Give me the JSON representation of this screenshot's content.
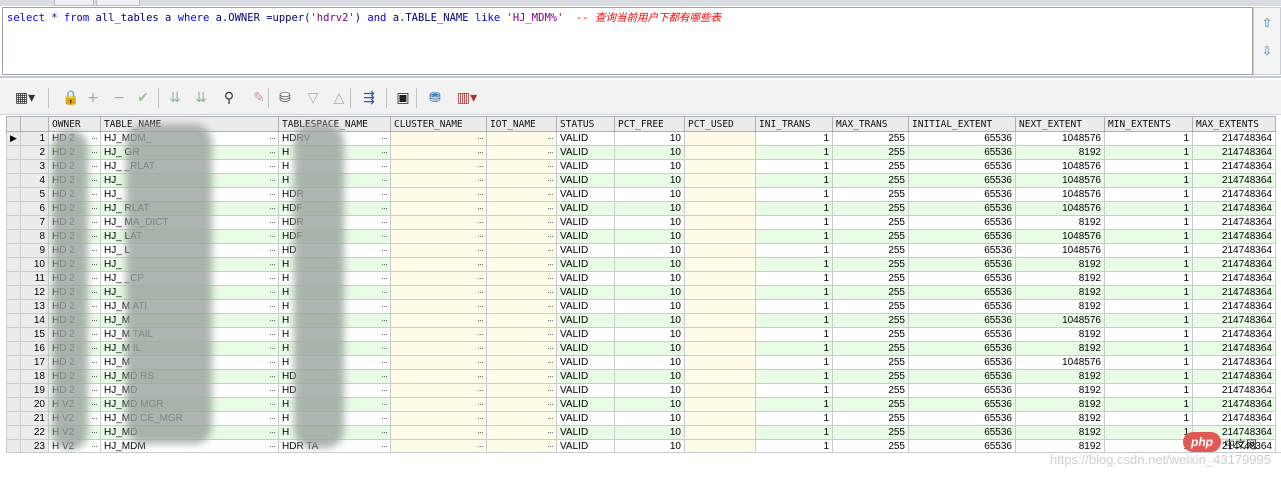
{
  "query": {
    "sql_parts": [
      {
        "t": "select",
        "c": "kw"
      },
      {
        "t": " * ",
        "c": ""
      },
      {
        "t": "from",
        "c": "kw"
      },
      {
        "t": " all_tables a ",
        "c": ""
      },
      {
        "t": "where",
        "c": "kw"
      },
      {
        "t": " a.OWNER =upper(",
        "c": ""
      },
      {
        "t": "'hdrv2'",
        "c": "str"
      },
      {
        "t": ") ",
        "c": ""
      },
      {
        "t": "and",
        "c": "kw"
      },
      {
        "t": " a.TABLE_NAME ",
        "c": ""
      },
      {
        "t": "like",
        "c": "kw"
      },
      {
        "t": " ",
        "c": ""
      },
      {
        "t": "'HJ_MDM%'",
        "c": "str"
      },
      {
        "t": "  -- 查询当前用户下都有哪些表",
        "c": "cmt"
      }
    ]
  },
  "editor_buttons": {
    "up": "⇧",
    "down": "⇩"
  },
  "toolbar": [
    {
      "name": "grid-menu-icon",
      "glyph": "▦▾",
      "color": "#333"
    },
    {
      "name": "lock-icon",
      "glyph": "🔒",
      "color": "#444"
    },
    {
      "name": "add-record-icon",
      "glyph": "+",
      "color": "#9aa"
    },
    {
      "name": "delete-record-icon",
      "glyph": "−",
      "color": "#9aa"
    },
    {
      "name": "post-changes-icon",
      "glyph": "✔",
      "color": "#9bc09b"
    },
    {
      "name": "fetch-next-icon",
      "glyph": "⇊",
      "color": "#8fb88f"
    },
    {
      "name": "fetch-last-icon",
      "glyph": "⇊",
      "color": "#8fb88f"
    },
    {
      "name": "find-icon",
      "glyph": "⚲",
      "color": "#333"
    },
    {
      "name": "clear-icon",
      "glyph": "✎",
      "color": "#c99"
    },
    {
      "name": "query-by-example-icon",
      "glyph": "⛁",
      "color": "#555"
    },
    {
      "name": "filter-down-icon",
      "glyph": "▽",
      "color": "#aaa"
    },
    {
      "name": "filter-up-icon",
      "glyph": "△",
      "color": "#aaa"
    },
    {
      "name": "link-icon",
      "glyph": "⇶",
      "color": "#2d5fa8"
    },
    {
      "name": "save-icon",
      "glyph": "▣",
      "color": "#222"
    },
    {
      "name": "export-icon",
      "glyph": "⛃",
      "color": "#2a6fb0"
    },
    {
      "name": "chart-menu-icon",
      "glyph": "▥▾",
      "color": "#b03030"
    }
  ],
  "columns": [
    "",
    "",
    "OWNER",
    "TABLE_NAME",
    "TABLESPACE_NAME",
    "CLUSTER_NAME",
    "IOT_NAME",
    "STATUS",
    "PCT_FREE",
    "PCT_USED",
    "INI_TRANS",
    "MAX_TRANS",
    "INITIAL_EXTENT",
    "NEXT_EXTENT",
    "MIN_EXTENTS",
    "MAX_EXTENTS"
  ],
  "rows": [
    {
      "n": "1",
      "owner": "HD 2",
      "table": "HJ_MDM_",
      "ts": "HDRV",
      "status": "VALID",
      "pct_free": "10",
      "ini": "1",
      "max": "255",
      "initial": "65536",
      "next": "1048576",
      "min": "1",
      "maxe": "214748364"
    },
    {
      "n": "2",
      "owner": "HD 2",
      "table": "HJ_          GR",
      "ts": "H",
      "status": "VALID",
      "pct_free": "10",
      "ini": "1",
      "max": "255",
      "initial": "65536",
      "next": "8192",
      "min": "1",
      "maxe": "214748364"
    },
    {
      "n": "3",
      "owner": "HD 2",
      "table": "HJ_          _RLAT",
      "ts": "H",
      "status": "VALID",
      "pct_free": "10",
      "ini": "1",
      "max": "255",
      "initial": "65536",
      "next": "1048576",
      "min": "1",
      "maxe": "214748364"
    },
    {
      "n": "4",
      "owner": "HD 2",
      "table": "HJ_",
      "ts": "H",
      "status": "VALID",
      "pct_free": "10",
      "ini": "1",
      "max": "255",
      "initial": "65536",
      "next": "1048576",
      "min": "1",
      "maxe": "214748364"
    },
    {
      "n": "5",
      "owner": "HD 2",
      "table": "HJ_",
      "ts": "HDR",
      "status": "VALID",
      "pct_free": "10",
      "ini": "1",
      "max": "255",
      "initial": "65536",
      "next": "1048576",
      "min": "1",
      "maxe": "214748364"
    },
    {
      "n": "6",
      "owner": "HD 2",
      "table": "HJ_         RLAT",
      "ts": "HDF",
      "status": "VALID",
      "pct_free": "10",
      "ini": "1",
      "max": "255",
      "initial": "65536",
      "next": "1048576",
      "min": "1",
      "maxe": "214748364"
    },
    {
      "n": "7",
      "owner": "HD 2",
      "table": "HJ_         MA_DICT",
      "ts": "HDR",
      "status": "VALID",
      "pct_free": "10",
      "ini": "1",
      "max": "255",
      "initial": "65536",
      "next": "8192",
      "min": "1",
      "maxe": "214748364"
    },
    {
      "n": "8",
      "owner": "HD 2",
      "table": "HJ_         LAT",
      "ts": "HDF",
      "status": "VALID",
      "pct_free": "10",
      "ini": "1",
      "max": "255",
      "initial": "65536",
      "next": "1048576",
      "min": "1",
      "maxe": "214748364"
    },
    {
      "n": "9",
      "owner": "HD 2",
      "table": "HJ_         L",
      "ts": "HD",
      "status": "VALID",
      "pct_free": "10",
      "ini": "1",
      "max": "255",
      "initial": "65536",
      "next": "1048576",
      "min": "1",
      "maxe": "214748364"
    },
    {
      "n": "10",
      "owner": "HD 2",
      "table": "HJ_",
      "ts": "H",
      "status": "VALID",
      "pct_free": "10",
      "ini": "1",
      "max": "255",
      "initial": "65536",
      "next": "8192",
      "min": "1",
      "maxe": "214748364"
    },
    {
      "n": "11",
      "owner": "HD 2",
      "table": "HJ_          _CP",
      "ts": "H",
      "status": "VALID",
      "pct_free": "10",
      "ini": "1",
      "max": "255",
      "initial": "65536",
      "next": "8192",
      "min": "1",
      "maxe": "214748364"
    },
    {
      "n": "12",
      "owner": "HD 2",
      "table": "HJ_",
      "ts": "H",
      "status": "VALID",
      "pct_free": "10",
      "ini": "1",
      "max": "255",
      "initial": "65536",
      "next": "8192",
      "min": "1",
      "maxe": "214748364"
    },
    {
      "n": "13",
      "owner": "HD 2",
      "table": "HJ_M         ATI",
      "ts": "H",
      "status": "VALID",
      "pct_free": "10",
      "ini": "1",
      "max": "255",
      "initial": "65536",
      "next": "8192",
      "min": "1",
      "maxe": "214748364"
    },
    {
      "n": "14",
      "owner": "HD 2",
      "table": "HJ_M",
      "ts": "H",
      "status": "VALID",
      "pct_free": "10",
      "ini": "1",
      "max": "255",
      "initial": "65536",
      "next": "1048576",
      "min": "1",
      "maxe": "214748364"
    },
    {
      "n": "15",
      "owner": "HD 2",
      "table": "HJ_M         TAIL",
      "ts": "H",
      "status": "VALID",
      "pct_free": "10",
      "ini": "1",
      "max": "255",
      "initial": "65536",
      "next": "8192",
      "min": "1",
      "maxe": "214748364"
    },
    {
      "n": "16",
      "owner": "HD 2",
      "table": "HJ_M         IL",
      "ts": "H",
      "status": "VALID",
      "pct_free": "10",
      "ini": "1",
      "max": "255",
      "initial": "65536",
      "next": "8192",
      "min": "1",
      "maxe": "214748364"
    },
    {
      "n": "17",
      "owner": "HD 2",
      "table": "HJ_M",
      "ts": "H",
      "status": "VALID",
      "pct_free": "10",
      "ini": "1",
      "max": "255",
      "initial": "65536",
      "next": "1048576",
      "min": "1",
      "maxe": "214748364"
    },
    {
      "n": "18",
      "owner": "HD 2",
      "table": "HJ_MD        RS",
      "ts": "HD",
      "status": "VALID",
      "pct_free": "10",
      "ini": "1",
      "max": "255",
      "initial": "65536",
      "next": "8192",
      "min": "1",
      "maxe": "214748364"
    },
    {
      "n": "19",
      "owner": "HD 2",
      "table": "HJ_MD",
      "ts": "HD",
      "status": "VALID",
      "pct_free": "10",
      "ini": "1",
      "max": "255",
      "initial": "65536",
      "next": "8192",
      "min": "1",
      "maxe": "214748364"
    },
    {
      "n": "20",
      "owner": "H V2",
      "table": "HJ_MD        MGR",
      "ts": "H",
      "status": "VALID",
      "pct_free": "10",
      "ini": "1",
      "max": "255",
      "initial": "65536",
      "next": "8192",
      "min": "1",
      "maxe": "214748364"
    },
    {
      "n": "21",
      "owner": "H V2",
      "table": "HJ_MD        CE_MGR",
      "ts": "H",
      "status": "VALID",
      "pct_free": "10",
      "ini": "1",
      "max": "255",
      "initial": "65536",
      "next": "8192",
      "min": "1",
      "maxe": "214748364"
    },
    {
      "n": "22",
      "owner": "H V2",
      "table": "HJ_MD",
      "ts": "H",
      "status": "VALID",
      "pct_free": "10",
      "ini": "1",
      "max": "255",
      "initial": "65536",
      "next": "8192",
      "min": "1",
      "maxe": "214748364"
    },
    {
      "n": "23",
      "owner": "H V2",
      "table": "HJ_MDM",
      "ts": "HDR      TA",
      "status": "VALID",
      "pct_free": "10",
      "ini": "1",
      "max": "255",
      "initial": "65536",
      "next": "8192",
      "min": "1",
      "maxe": "214748364"
    }
  ],
  "overlay": {
    "php_badge": "php",
    "cn_label": "中文网",
    "watermark": "https://blog.csdn.net/weixin_43179995"
  },
  "colors": {
    "row_alt": "#e8fbe4",
    "empty_cell": "#fffde8",
    "comment": "#ff0000",
    "keyword": "#0000ff"
  }
}
